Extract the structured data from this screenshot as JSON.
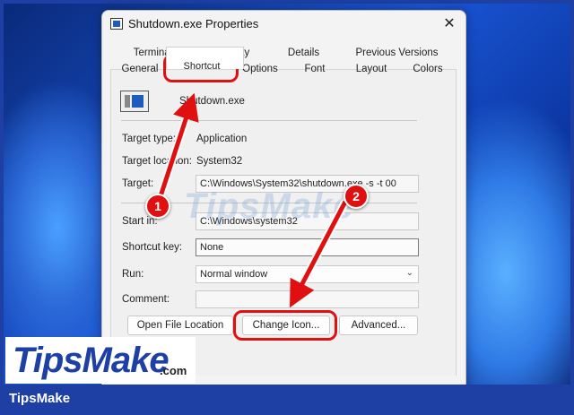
{
  "window": {
    "title": "Shutdown.exe Properties",
    "close_glyph": "✕"
  },
  "tabs": {
    "row1": [
      "Terminal",
      "Security",
      "Details",
      "Previous Versions"
    ],
    "row2": [
      "General",
      "Shortcut",
      "Options",
      "Font",
      "Layout",
      "Colors"
    ],
    "active": "Shortcut"
  },
  "shortcut": {
    "name": "Shutdown.exe",
    "target_type_label": "Target type:",
    "target_type": "Application",
    "target_location_label": "Target location:",
    "target_location": "System32",
    "target_label": "Target:",
    "target": "C:\\Windows\\System32\\shutdown.exe -s -t 00",
    "start_in_label": "Start in:",
    "start_in": "C:\\Windows\\system32",
    "shortcut_key_label": "Shortcut key:",
    "shortcut_key": "None",
    "run_label": "Run:",
    "run": "Normal window",
    "comment_label": "Comment:",
    "comment": ""
  },
  "buttons": {
    "open_file_location": "Open File Location",
    "change_icon": "Change Icon...",
    "advanced": "Advanced..."
  },
  "annotations": {
    "step1": "1",
    "step2": "2",
    "accent": "#e01010"
  },
  "watermark": "TipsMake",
  "logo": {
    "main": "TipsMake",
    "suffix": ".com"
  },
  "footer": {
    "brand": "TipsMake"
  }
}
